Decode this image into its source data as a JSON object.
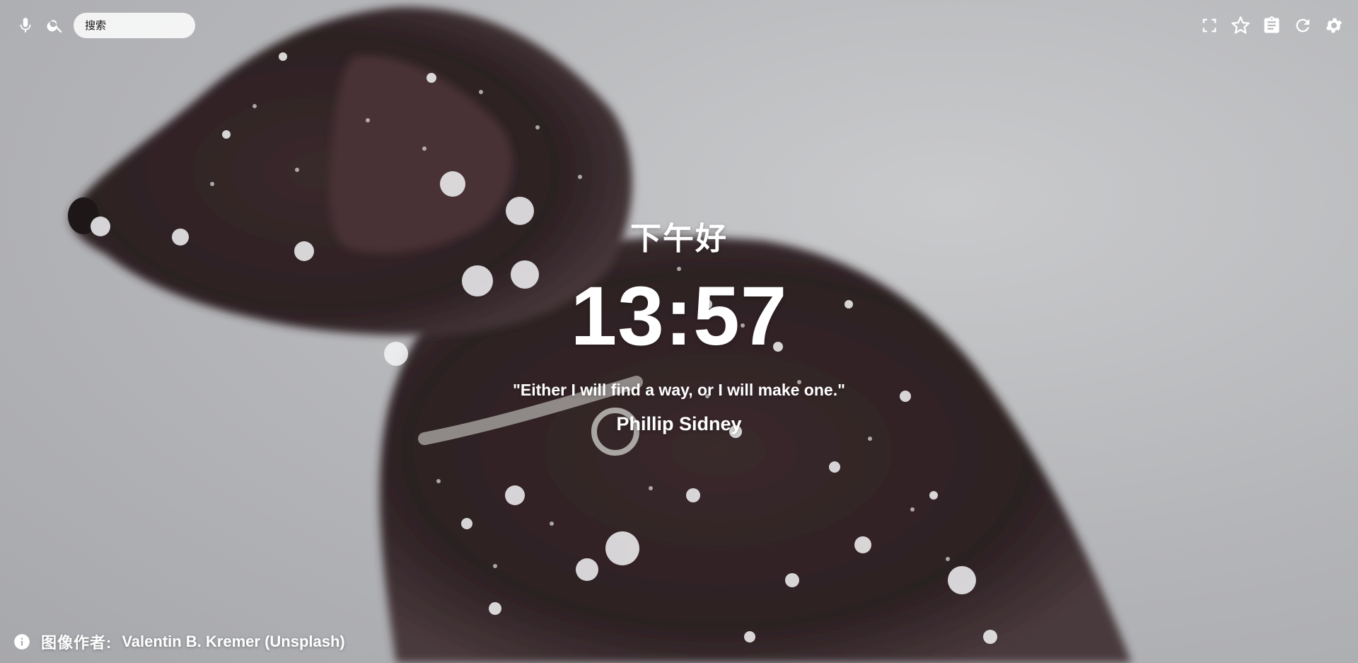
{
  "search": {
    "placeholder": "搜索",
    "icons": [
      "mic-icon",
      "search-icon"
    ]
  },
  "toolbar": {
    "icons": [
      "fullscreen-icon",
      "star-icon",
      "clipboard-icon",
      "refresh-icon",
      "gear-icon"
    ]
  },
  "main": {
    "greeting": "下午好",
    "time": "13:57",
    "quote": "\"Either I will find a way, or I will make one.\"",
    "quote_author": "Phillip Sidney"
  },
  "credit": {
    "label": "图像作者:",
    "photographer": "Valentin B. Kremer (Unsplash)",
    "icon": "info-icon"
  },
  "colors": {
    "text": "#ffffff",
    "background": "#b4b5b8",
    "search_bg": "#eeeeee"
  }
}
